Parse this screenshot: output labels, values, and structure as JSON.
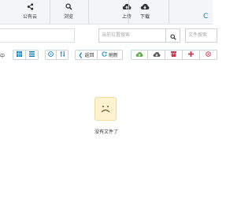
{
  "topbar": {
    "items": [
      {
        "label": "公有云",
        "icon": "share-icon"
      },
      {
        "label": "浏览",
        "icon": "search-icon"
      },
      {
        "label": "上传",
        "icon": "cloud-upload-icon"
      },
      {
        "label": "下载",
        "icon": "cloud-download-icon"
      }
    ],
    "refresh_glyph": "C"
  },
  "search": {
    "placeholder": "当前位置搜索",
    "placeholder2": "文件搜索"
  },
  "toolbar": {
    "cut_label": "中",
    "back_label": "返回",
    "refresh_label": "刷新"
  },
  "empty": {
    "message": "没有文件了"
  },
  "colors": {
    "accent": "#0b7fc4",
    "green": "#5ea94a",
    "red": "#c43b52",
    "empty_icon": "#fff2d0"
  }
}
